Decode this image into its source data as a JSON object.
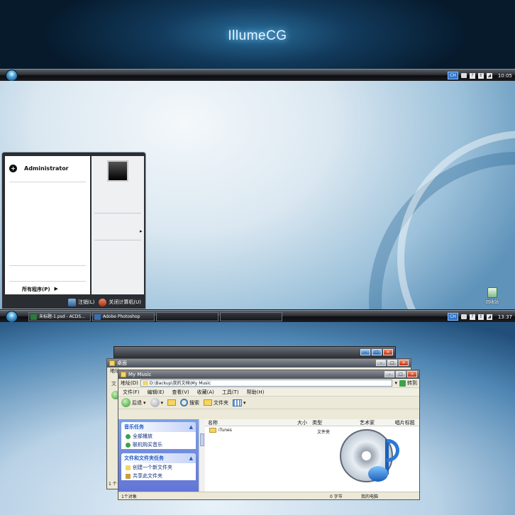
{
  "banner": {
    "title": "IllumeCG"
  },
  "taskbar_top": {
    "lang": "CH",
    "clock": "10:05"
  },
  "start_menu": {
    "user": "Administrator",
    "all_programs": "所有程序(P)",
    "all_programs_arrow": "▶",
    "right_arrow": "▸",
    "logoff": "注销(L)",
    "shutdown": "关闭计算机(U)"
  },
  "desktop": {
    "recycle_bin": "回收站"
  },
  "taskbar_bottom": {
    "lang": "CH",
    "clock": "13:37",
    "buttons": [
      {
        "label": "未标题-1.psd - ACDS..."
      },
      {
        "label": "Adobe Photoshop"
      },
      {
        "label": ""
      },
      {
        "label": ""
      }
    ]
  },
  "window_mid": {
    "title": "桌面",
    "address_fragment": "地址",
    "menu_fragment": "文",
    "status_fragment": "1 个"
  },
  "window_front": {
    "title": "My Music",
    "menu": [
      "文件(F)",
      "编辑(E)",
      "查看(V)",
      "收藏(A)",
      "工具(T)",
      "帮助(H)"
    ],
    "address_label": "地址(D)",
    "address_value": "D:\\Backup\\我的文档\\My Music",
    "go_label": "转到",
    "toolbar": {
      "back": "后退",
      "search": "搜索",
      "folders": "文件夹"
    },
    "music_tasks": {
      "header": "音乐任务",
      "items": [
        "全部播放",
        "联机购买音乐"
      ]
    },
    "file_tasks": {
      "header": "文件和文件夹任务",
      "items": [
        "创建一个新文件夹",
        "共享此文件夹"
      ]
    },
    "columns": [
      "名称",
      "大小",
      "类型",
      "艺术家",
      "唱片标题"
    ],
    "files": [
      {
        "name": "iTunes",
        "type": "文件夹"
      }
    ],
    "status": {
      "count": "1个对象",
      "size": "0 字节",
      "location": "我的电脑"
    }
  }
}
